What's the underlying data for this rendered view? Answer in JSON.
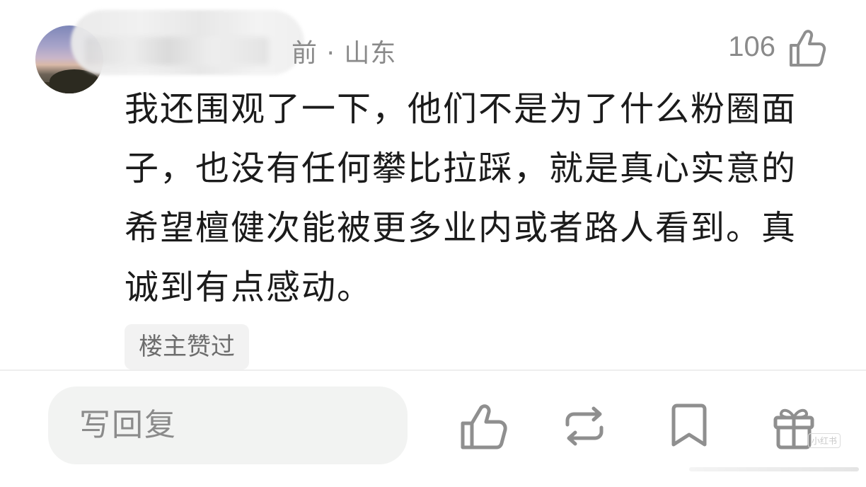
{
  "comment": {
    "meta": "前 · 山东",
    "like_count": "106",
    "text": "我还围观了一下，他们不是为了什么粉圈面子，也没有任何攀比拉踩，就是真心实意的希望檀健次能被更多业内或者路人看到。真诚到有点感动。",
    "badge": "楼主赞过"
  },
  "bottom_bar": {
    "reply_placeholder": "写回复",
    "actions": [
      "like-icon",
      "repost-icon",
      "bookmark-icon",
      "gift-icon"
    ]
  },
  "watermark": "小红书",
  "colors": {
    "text": "#1b1b1b",
    "muted": "#8a8a8a",
    "input_bg": "#f2f3f2",
    "icon_stroke": "#8f8f8f"
  }
}
